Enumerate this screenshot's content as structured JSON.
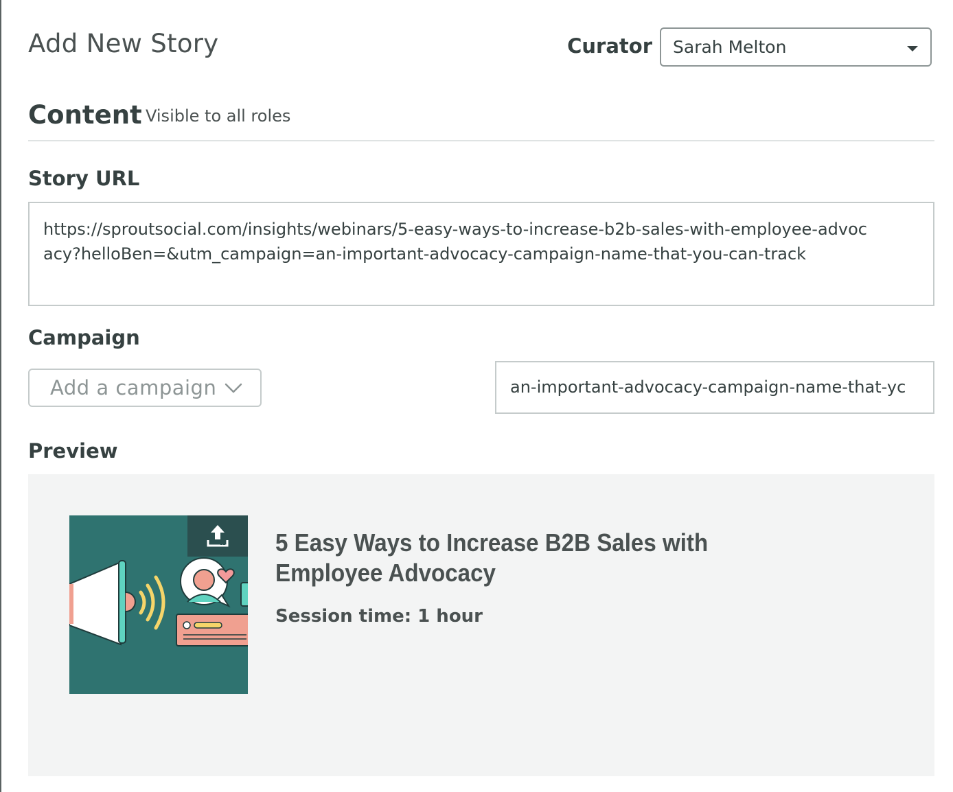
{
  "header": {
    "title": "Add New Story",
    "curator_label": "Curator",
    "curator_value": "Sarah Melton"
  },
  "content": {
    "heading": "Content",
    "subheading": "Visible to all roles"
  },
  "story_url": {
    "label": "Story URL",
    "value": "https://sproutsocial.com/insights/webinars/5-easy-ways-to-increase-b2b-sales-with-employee-advocacy?helloBen=&utm_campaign=an-important-advocacy-campaign-name-that-you-can-track"
  },
  "campaign": {
    "label": "Campaign",
    "placeholder": "Add a campaign",
    "utm_value": "an-important-advocacy-campaign-name-that-yc"
  },
  "preview": {
    "label": "Preview",
    "title": "5 Easy Ways to Increase B2B Sales with Employee Advocacy",
    "session": "Session time: 1 hour"
  }
}
